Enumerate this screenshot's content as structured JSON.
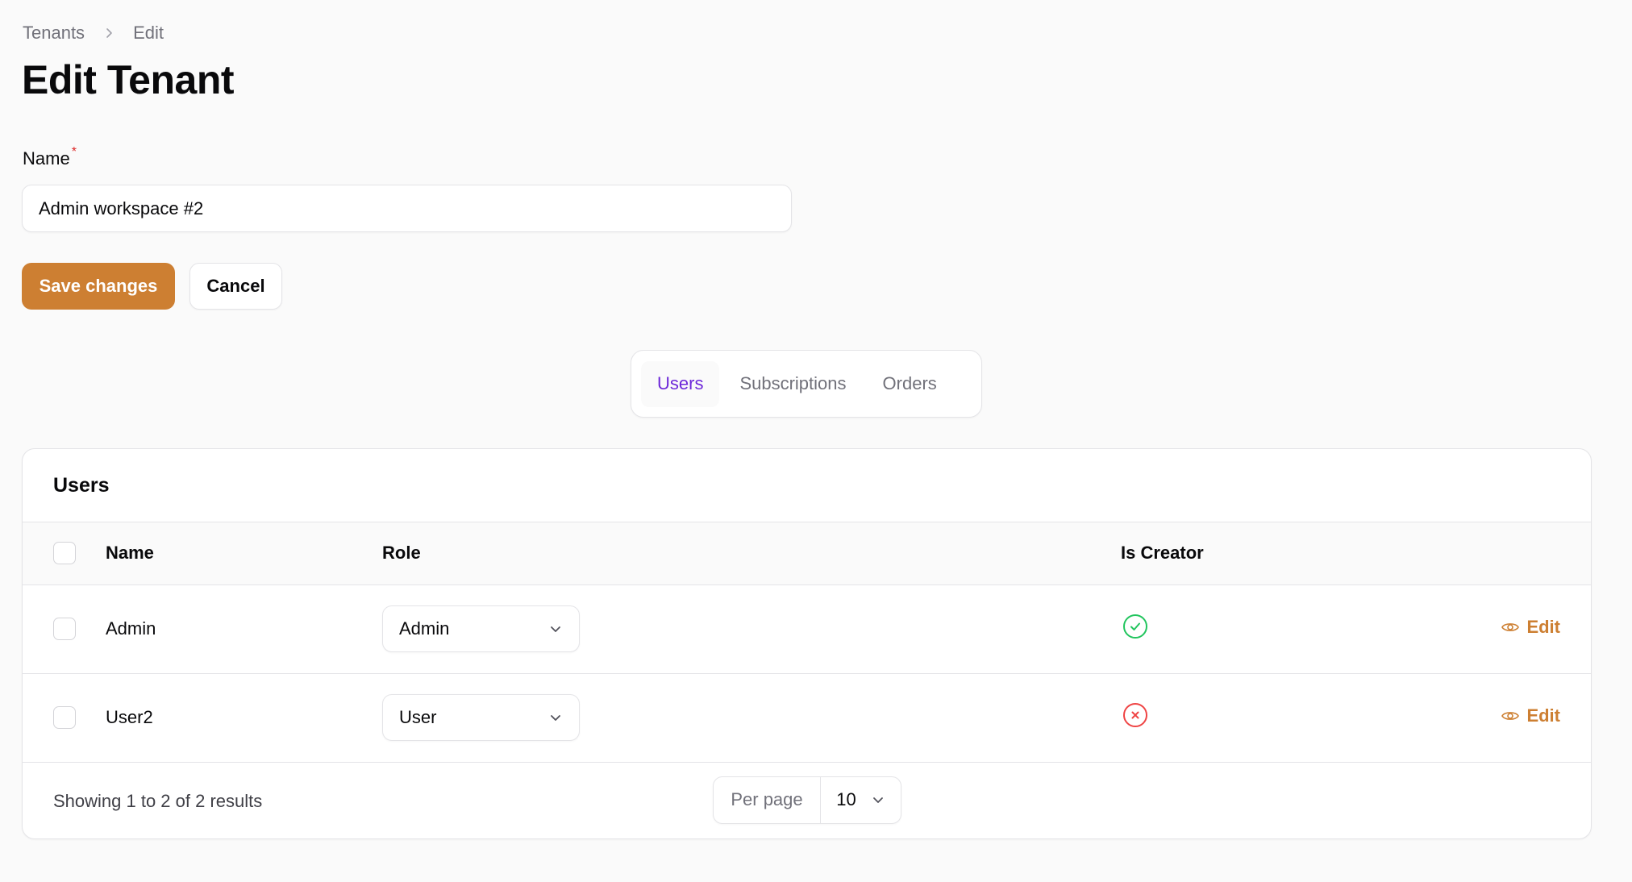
{
  "breadcrumb": {
    "items": [
      "Tenants",
      "Edit"
    ],
    "separator_icon": "chevron-right-icon"
  },
  "page": {
    "title": "Edit Tenant"
  },
  "form": {
    "name_label": "Name",
    "required_marker": "*",
    "name_value": "Admin workspace #2",
    "save_label": "Save changes",
    "cancel_label": "Cancel"
  },
  "tabs": [
    {
      "label": "Users",
      "active": true
    },
    {
      "label": "Subscriptions",
      "active": false
    },
    {
      "label": "Orders",
      "active": false
    }
  ],
  "users_table": {
    "title": "Users",
    "columns": [
      "Name",
      "Role",
      "Is Creator",
      ""
    ],
    "rows": [
      {
        "name": "Admin",
        "role": "Admin",
        "is_creator": true,
        "action_label": "Edit"
      },
      {
        "name": "User2",
        "role": "User",
        "is_creator": false,
        "action_label": "Edit"
      }
    ],
    "footer": {
      "summary": "Showing 1 to 2 of 2 results",
      "per_page_label": "Per page",
      "per_page_value": "10"
    }
  },
  "colors": {
    "primary": "#cd7f32",
    "tab_active": "#6d28d9",
    "success": "#22c55e",
    "danger": "#ef4444"
  }
}
